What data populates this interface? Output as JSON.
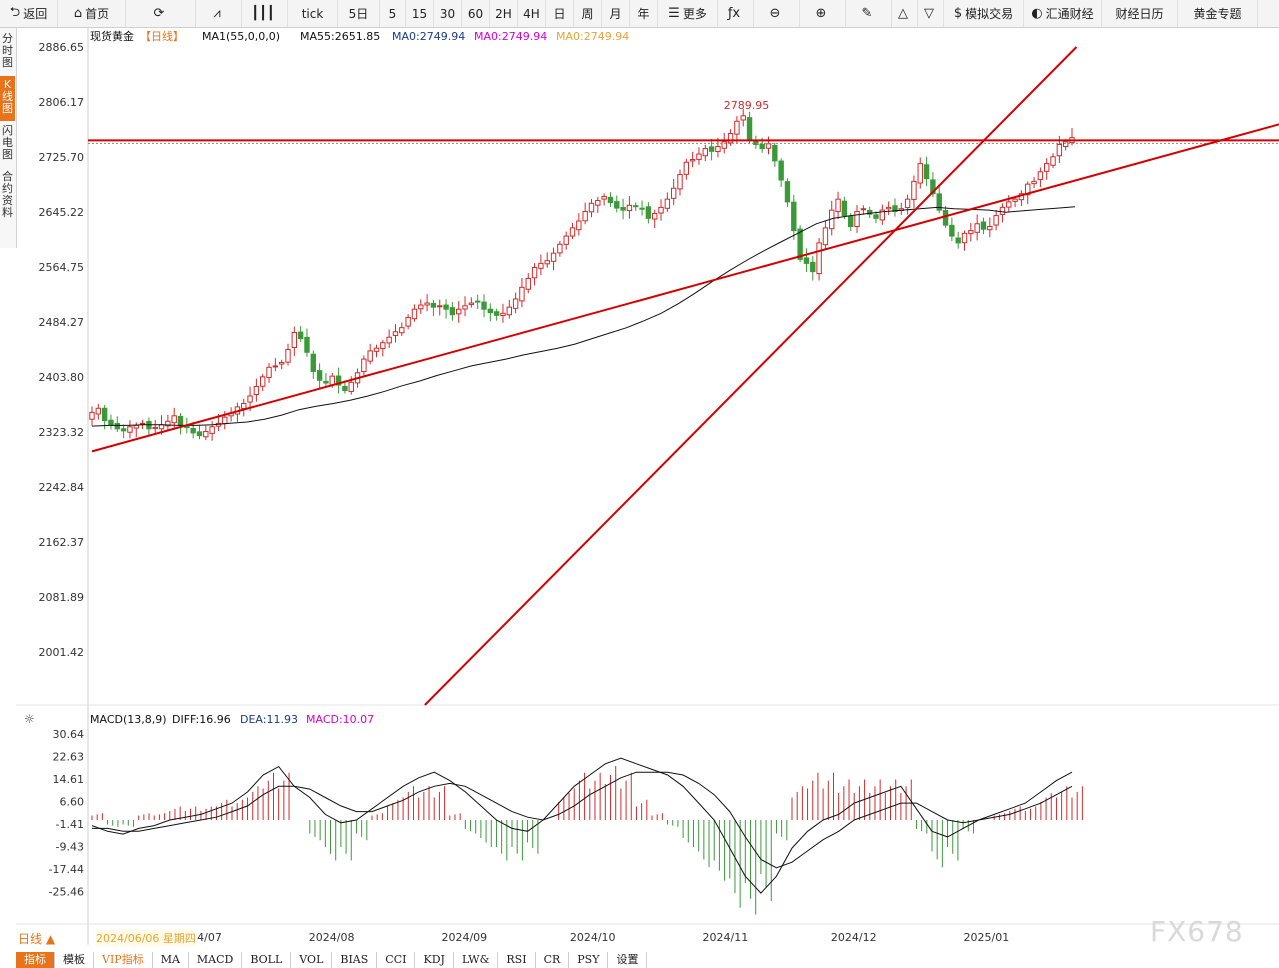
{
  "toolbar": {
    "items": [
      {
        "icon": "back-arrow-icon",
        "glyph": "⮌",
        "label": "返回",
        "w": 58
      },
      {
        "icon": "home-icon",
        "glyph": "⌂",
        "label": "首页",
        "w": 68
      },
      {
        "icon": "refresh-icon",
        "glyph": "⟳",
        "label": "",
        "w": 70
      },
      {
        "icon": "chart-type-icon",
        "glyph": "⩘",
        "label": "",
        "w": 46
      },
      {
        "icon": "candle-icon",
        "glyph": "┃┃┃",
        "label": "",
        "w": 46
      },
      {
        "icon": "",
        "glyph": "",
        "label": "tick",
        "w": 50
      },
      {
        "icon": "",
        "glyph": "",
        "label": "5日",
        "w": 42
      },
      {
        "icon": "",
        "glyph": "",
        "label": "5",
        "w": 26
      },
      {
        "icon": "",
        "glyph": "",
        "label": "15",
        "w": 28
      },
      {
        "icon": "",
        "glyph": "",
        "label": "30",
        "w": 28
      },
      {
        "icon": "",
        "glyph": "",
        "label": "60",
        "w": 28
      },
      {
        "icon": "",
        "glyph": "",
        "label": "2H",
        "w": 28
      },
      {
        "icon": "",
        "glyph": "",
        "label": "4H",
        "w": 28
      },
      {
        "icon": "",
        "glyph": "",
        "label": "日",
        "w": 28
      },
      {
        "icon": "",
        "glyph": "",
        "label": "周",
        "w": 28
      },
      {
        "icon": "",
        "glyph": "",
        "label": "月",
        "w": 28
      },
      {
        "icon": "",
        "glyph": "",
        "label": "年",
        "w": 28
      },
      {
        "icon": "menu-icon",
        "glyph": "☰",
        "label": "更多",
        "w": 60
      },
      {
        "icon": "formula-icon",
        "glyph": "ƒx",
        "label": "",
        "w": 36
      },
      {
        "icon": "zoom-out-icon",
        "glyph": "⊖",
        "label": "",
        "w": 46
      },
      {
        "icon": "zoom-in-icon",
        "glyph": "⊕",
        "label": "",
        "w": 46
      },
      {
        "icon": "draw-pen-icon",
        "glyph": "✎",
        "label": "",
        "w": 46
      },
      {
        "icon": "triangle-up-icon",
        "glyph": "△",
        "label": "",
        "w": 26
      },
      {
        "icon": "triangle-down-icon",
        "glyph": "▽",
        "label": "",
        "w": 26
      },
      {
        "icon": "dollar-icon",
        "glyph": "$",
        "label": "模拟交易",
        "w": 80
      },
      {
        "icon": "huitong-logo-icon",
        "glyph": "◐",
        "label": "汇通财经",
        "w": 78
      },
      {
        "icon": "",
        "glyph": "",
        "label": "财经日历",
        "w": 76
      },
      {
        "icon": "",
        "glyph": "",
        "label": "黄金专题",
        "w": 80
      }
    ]
  },
  "left_tabs": [
    {
      "label": "分时图",
      "active": false
    },
    {
      "label": "K线图",
      "active": true
    },
    {
      "label": "闪电图",
      "active": false
    },
    {
      "label": "合约资料",
      "active": false
    }
  ],
  "legend": {
    "symbol": "现货黄金",
    "period": "【日线】",
    "ma1": "MA1(55,0,0,0)",
    "ma55": "MA55:2651.85",
    "ma0a": "MA0:2749.94",
    "ma0b": "MA0:2749.94",
    "ma0c": "MA0:2749.94"
  },
  "macd_legend": {
    "name": "MACD(13,8,9)",
    "diff": "DIFF:16.96",
    "dea": "DEA:11.93",
    "macd": "MACD:10.07"
  },
  "colors": {
    "up": "#d22b2b",
    "down": "#3a9a3a",
    "trend": "#d40000",
    "ma": "#111111",
    "accent": "#e8731a"
  },
  "chart_data": [
    {
      "type": "candlestick",
      "title": "现货黄金【日线】",
      "ylim": [
        2001.42,
        2886.65
      ],
      "y_ticks": [
        "2886.65",
        "2806.17",
        "2725.70",
        "2645.22",
        "2564.75",
        "2484.27",
        "2403.80",
        "2323.32",
        "2242.84",
        "2162.37",
        "2081.89",
        "2001.42"
      ],
      "x_ticks": [
        "2024/07",
        "2024/08",
        "2024/09",
        "2024/10",
        "2024/11",
        "2024/12",
        "2025/01"
      ],
      "x_range": [
        "2024-06-06",
        "2025-01-21"
      ],
      "high_annotation": {
        "label": "2789.95",
        "value": 2789.95
      },
      "close_series": [
        2352,
        2358,
        2340,
        2334,
        2328,
        2325,
        2331,
        2333,
        2336,
        2328,
        2330,
        2334,
        2339,
        2347,
        2333,
        2330,
        2322,
        2318,
        2324,
        2331,
        2336,
        2345,
        2351,
        2360,
        2365,
        2376,
        2390,
        2404,
        2418,
        2420,
        2425,
        2444,
        2469,
        2460,
        2440,
        2412,
        2399,
        2395,
        2405,
        2392,
        2384,
        2396,
        2410,
        2430,
        2442,
        2446,
        2454,
        2462,
        2470,
        2476,
        2491,
        2503,
        2509,
        2512,
        2506,
        2508,
        2503,
        2495,
        2503,
        2508,
        2512,
        2514,
        2503,
        2498,
        2494,
        2497,
        2506,
        2518,
        2535,
        2548,
        2564,
        2570,
        2574,
        2585,
        2598,
        2610,
        2622,
        2632,
        2646,
        2658,
        2662,
        2668,
        2659,
        2651,
        2648,
        2655,
        2653,
        2650,
        2636,
        2643,
        2652,
        2664,
        2680,
        2700,
        2718,
        2722,
        2730,
        2738,
        2734,
        2741,
        2748,
        2760,
        2778,
        2786,
        2750,
        2744,
        2738,
        2745,
        2720,
        2692,
        2660,
        2618,
        2576,
        2570,
        2558,
        2600,
        2622,
        2648,
        2664,
        2640,
        2624,
        2646,
        2650,
        2642,
        2636,
        2648,
        2652,
        2646,
        2650,
        2664,
        2690,
        2716,
        2694,
        2672,
        2648,
        2626,
        2610,
        2600,
        2614,
        2618,
        2628,
        2620,
        2624,
        2640,
        2652,
        2660,
        2664,
        2672,
        2686,
        2690,
        2704,
        2716,
        2726,
        2744,
        2748,
        2754
      ],
      "ma55_series": [
        2332,
        2333,
        2333,
        2334,
        2334,
        2333,
        2333,
        2334,
        2336,
        2338,
        2342,
        2348,
        2356,
        2361,
        2365,
        2370,
        2376,
        2383,
        2391,
        2398,
        2406,
        2413,
        2420,
        2425,
        2430,
        2436,
        2441,
        2446,
        2452,
        2460,
        2468,
        2476,
        2486,
        2497,
        2511,
        2527,
        2544,
        2560,
        2575,
        2589,
        2602,
        2615,
        2628,
        2636,
        2640,
        2643,
        2646,
        2648,
        2650,
        2652,
        2650,
        2649,
        2648,
        2645,
        2647,
        2649,
        2651,
        2653
      ],
      "trendlines": [
        {
          "from": [
            "2024-06-06",
            2295
          ],
          "to": [
            "2025-01-21",
            2690
          ]
        },
        {
          "from": [
            "2024-08-19",
            1900
          ],
          "to": [
            "2025-01-21",
            2880
          ]
        },
        {
          "horizontal": 2749.94
        }
      ]
    },
    {
      "type": "bar+line",
      "title": "MACD(13,8,9)",
      "ylim": [
        -32,
        32
      ],
      "y_ticks": [
        "30.64",
        "22.63",
        "14.61",
        "6.60",
        "-1.41",
        "-9.43",
        "-17.44",
        "-25.46"
      ],
      "diff": [
        -2,
        -4,
        -5,
        -3,
        -2,
        0,
        1,
        2,
        4,
        6,
        10,
        16,
        19,
        12,
        8,
        2,
        -1,
        0,
        4,
        8,
        12,
        15,
        17,
        14,
        10,
        5,
        0,
        -3,
        -4,
        0,
        6,
        12,
        16,
        20,
        22,
        20,
        18,
        16,
        12,
        6,
        0,
        -10,
        -20,
        -26,
        -20,
        -10,
        -4,
        0,
        2,
        6,
        8,
        10,
        12,
        4,
        -4,
        -6,
        -3,
        0,
        2,
        4,
        6,
        10,
        14,
        17
      ],
      "dea": [
        -3,
        -3,
        -4,
        -4,
        -3,
        -2,
        -1,
        0,
        1,
        3,
        5,
        9,
        12,
        12,
        11,
        8,
        5,
        3,
        3,
        5,
        7,
        10,
        12,
        13,
        12,
        9,
        6,
        3,
        1,
        0,
        2,
        5,
        9,
        12,
        15,
        17,
        17,
        17,
        16,
        13,
        9,
        3,
        -6,
        -14,
        -17,
        -15,
        -11,
        -7,
        -4,
        0,
        2,
        4,
        6,
        6,
        3,
        0,
        -1,
        0,
        1,
        2,
        4,
        6,
        9,
        12
      ]
    }
  ],
  "bottom": {
    "day_label": "日线 ▲",
    "date_info": "2024/06/06 星期四",
    "tabs": [
      "指标",
      "模板",
      "VIP指标",
      "MA",
      "MACD",
      "BOLL",
      "VOL",
      "BIAS",
      "CCI",
      "KDJ",
      "LW&",
      "RSI",
      "CR",
      "PSY",
      "设置"
    ],
    "active_tab": "指标"
  },
  "watermark": "FX678"
}
